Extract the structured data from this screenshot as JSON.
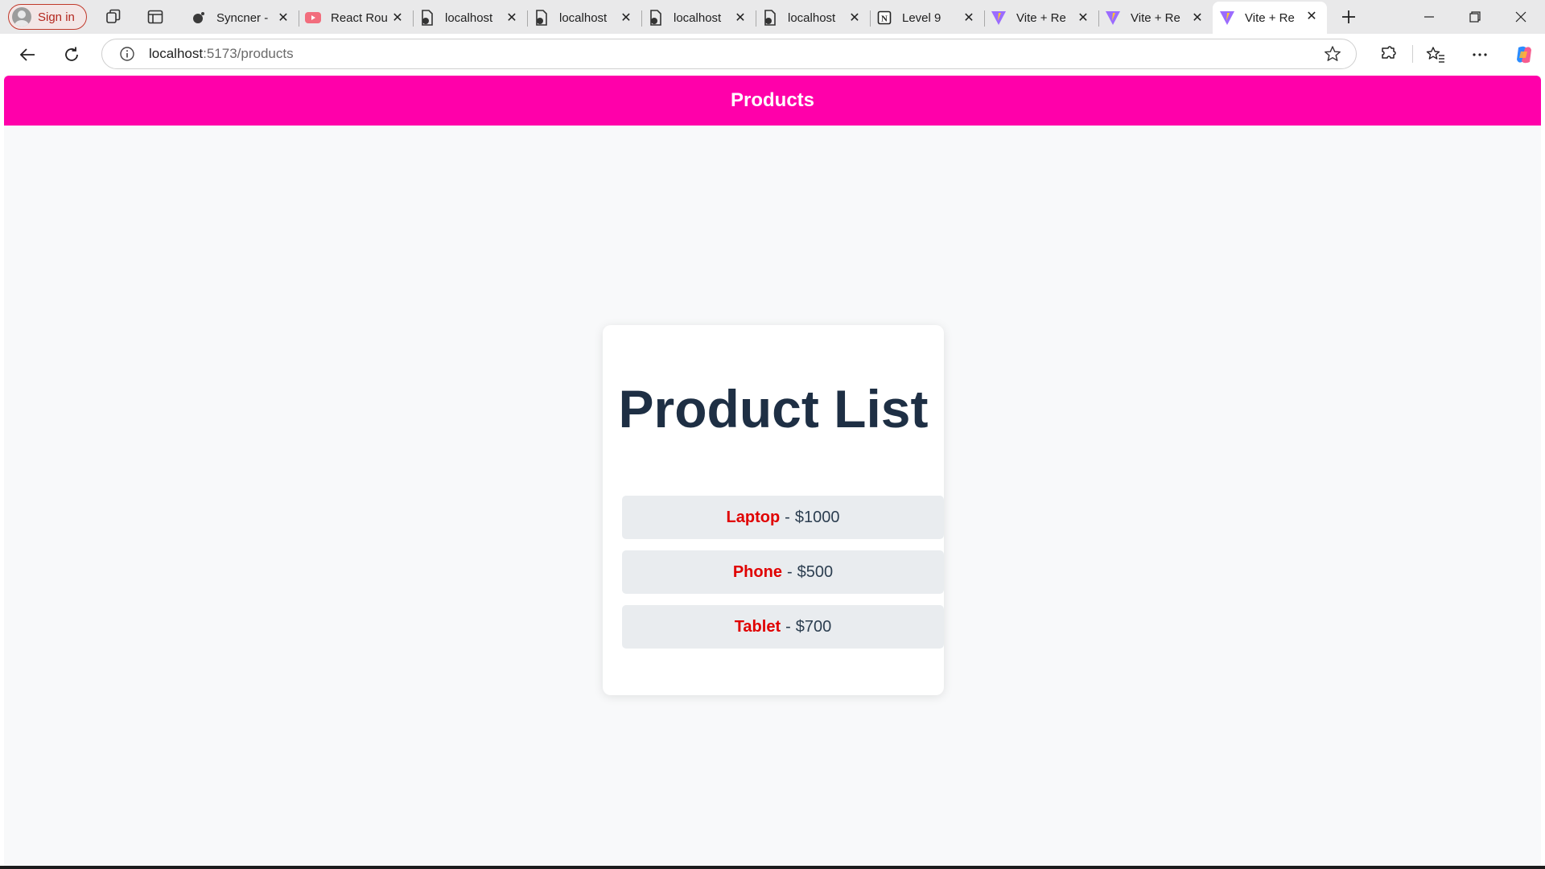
{
  "browser": {
    "signin_label": "Sign in",
    "tabs": [
      {
        "title": "Syncner -",
        "favicon": "syncner-icon"
      },
      {
        "title": "React Rou",
        "favicon": "youtube-icon"
      },
      {
        "title": "localhost",
        "favicon": "document-icon"
      },
      {
        "title": "localhost",
        "favicon": "document-icon"
      },
      {
        "title": "localhost",
        "favicon": "document-icon"
      },
      {
        "title": "localhost",
        "favicon": "document-icon"
      },
      {
        "title": "Level 9",
        "favicon": "notion-icon"
      },
      {
        "title": "Vite + Re",
        "favicon": "vite-icon"
      },
      {
        "title": "Vite + Re",
        "favicon": "vite-icon"
      },
      {
        "title": "Vite + Re",
        "favicon": "vite-icon"
      }
    ],
    "address": {
      "host": "localhost",
      "path": ":5173/products"
    }
  },
  "page": {
    "header_title": "Products",
    "card_title": "Product List",
    "products": [
      {
        "name": "Laptop",
        "separator": "-",
        "price": "$1000"
      },
      {
        "name": "Phone",
        "separator": "-",
        "price": "$500"
      },
      {
        "name": "Tablet",
        "separator": "-",
        "price": "$700"
      }
    ]
  },
  "colors": {
    "header_bg": "#ff00aa",
    "product_name": "#e00000",
    "title_text": "#1e2f44",
    "item_bg": "#e9ecef"
  }
}
